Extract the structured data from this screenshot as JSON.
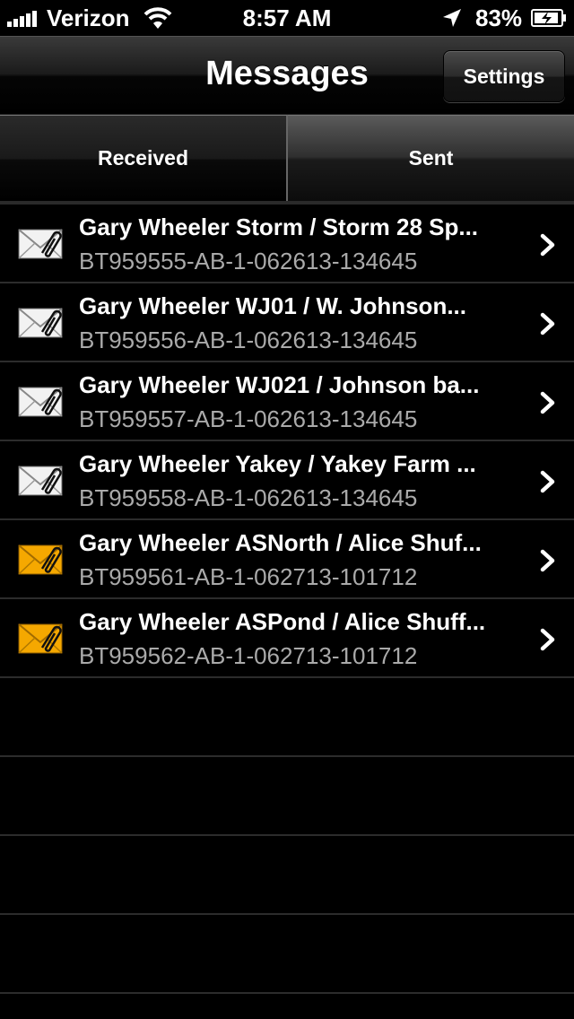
{
  "status_bar": {
    "carrier": "Verizon",
    "time": "8:57 AM",
    "battery_percent": "83%"
  },
  "nav": {
    "title": "Messages",
    "settings_label": "Settings"
  },
  "tabs": [
    {
      "label": "Received",
      "selected": true
    },
    {
      "label": "Sent",
      "selected": false
    }
  ],
  "messages": [
    {
      "title": "Gary Wheeler Storm / Storm 28 Sp...",
      "subtitle": "BT959555-AB-1-062613-134645",
      "icon": "read-envelope-attachment-icon",
      "envelope_color": "#f2f2f2"
    },
    {
      "title": "Gary Wheeler WJ01 / W. Johnson...",
      "subtitle": "BT959556-AB-1-062613-134645",
      "icon": "read-envelope-attachment-icon",
      "envelope_color": "#f2f2f2"
    },
    {
      "title": "Gary Wheeler WJ021 / Johnson ba...",
      "subtitle": "BT959557-AB-1-062613-134645",
      "icon": "read-envelope-attachment-icon",
      "envelope_color": "#f2f2f2"
    },
    {
      "title": "Gary Wheeler Yakey / Yakey Farm ...",
      "subtitle": "BT959558-AB-1-062613-134645",
      "icon": "read-envelope-attachment-icon",
      "envelope_color": "#f2f2f2"
    },
    {
      "title": "Gary Wheeler ASNorth / Alice Shuf...",
      "subtitle": "BT959561-AB-1-062713-101712",
      "icon": "unread-envelope-attachment-icon",
      "envelope_color": "#f5a800"
    },
    {
      "title": "Gary Wheeler ASPond / Alice Shuff...",
      "subtitle": "BT959562-AB-1-062713-101712",
      "icon": "unread-envelope-attachment-icon",
      "envelope_color": "#f5a800"
    }
  ]
}
